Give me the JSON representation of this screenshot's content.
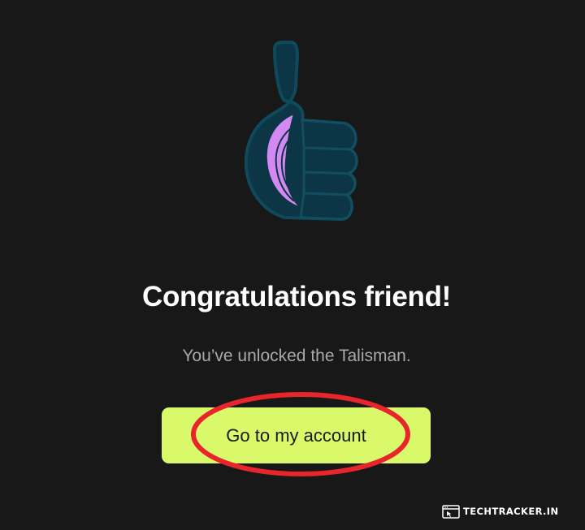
{
  "illustration": {
    "icon": "thumbs-up-icon"
  },
  "headline": "Congratulations friend!",
  "subtext": "You’ve unlocked the Talisman.",
  "cta": {
    "label": "Go to my account"
  },
  "watermark": {
    "text": "TECHTRACKER.IN",
    "icon": "browser-window-icon"
  },
  "colors": {
    "background": "#181818",
    "cta": "#d9f86a",
    "highlight": "#e8242c",
    "thumb": "#0c3546",
    "accent": "#d489f2"
  }
}
